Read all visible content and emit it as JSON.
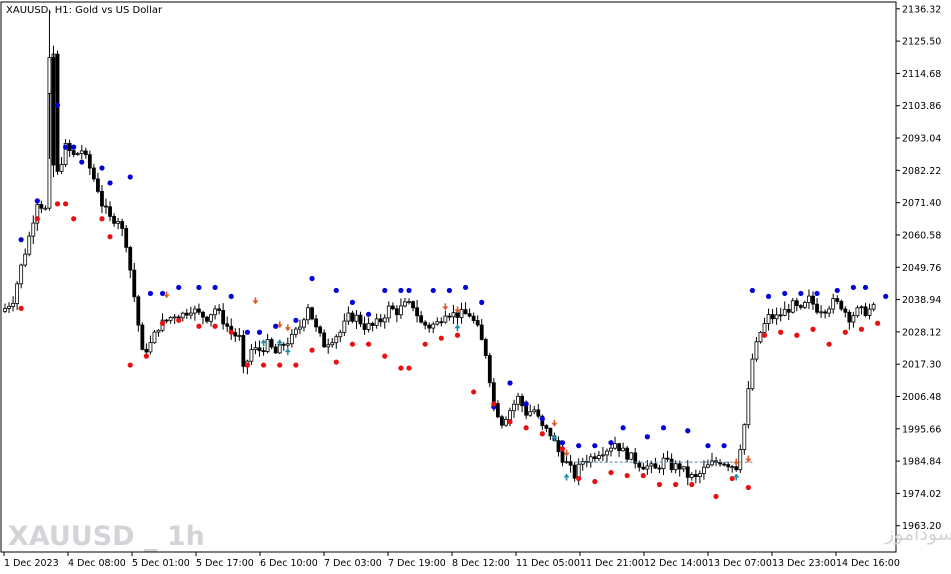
{
  "chart_title": "XAUUSD, H1:  Gold vs US Dollar",
  "watermark_symbol": "XAUUSD _ 1h",
  "watermark_site": "انتشار در سایت سودآموز",
  "colors": {
    "background": "#ffffff",
    "candle_bull": "#ffffff",
    "candle_bear": "#000000",
    "signal_high": "#0000d8",
    "signal_low": "#e81010",
    "arrow_down": "#e05a2a",
    "arrow_up": "#1d8fb0",
    "level_line": "#5a8a9c"
  },
  "chart_data": {
    "type": "candlestick",
    "symbol": "XAUUSD",
    "timeframe": "H1",
    "ylim": [
      1954.4,
      2138.6
    ],
    "yticks": [
      "2136.32",
      "2125.50",
      "2114.68",
      "2103.86",
      "2093.04",
      "2082.22",
      "2071.40",
      "2060.58",
      "2049.76",
      "2038.94",
      "2028.12",
      "2017.30",
      "2006.48",
      "1995.66",
      "1984.84",
      "1974.02",
      "1963.20"
    ],
    "xticks": [
      "1 Dec 2023",
      "4 Dec 08:00",
      "5 Dec 01:00",
      "5 Dec 17:00",
      "6 Dec 10:00",
      "7 Dec 03:00",
      "7 Dec 19:00",
      "8 Dec 12:00",
      "11 Dec 05:00",
      "11 Dec 21:00",
      "12 Dec 14:00",
      "13 Dec 07:00",
      "13 Dec 23:00",
      "14 Dec 16:00"
    ],
    "close_path": [
      [
        0,
        2036
      ],
      [
        2,
        2039
      ],
      [
        4,
        2050
      ],
      [
        6,
        2060
      ],
      [
        8,
        2072
      ],
      [
        10,
        2069
      ],
      [
        11,
        2107
      ],
      [
        12,
        2121
      ],
      [
        13,
        2081
      ],
      [
        15,
        2090
      ],
      [
        17,
        2087
      ],
      [
        19,
        2089
      ],
      [
        21,
        2083
      ],
      [
        23,
        2076
      ],
      [
        24,
        2071
      ],
      [
        26,
        2066
      ],
      [
        28,
        2066
      ],
      [
        30,
        2058
      ],
      [
        32,
        2040
      ],
      [
        34,
        2021
      ],
      [
        36,
        2024
      ],
      [
        38,
        2030
      ],
      [
        40,
        2032
      ],
      [
        42,
        2034
      ],
      [
        44,
        2034
      ],
      [
        46,
        2036
      ],
      [
        48,
        2034
      ],
      [
        50,
        2033
      ],
      [
        52,
        2036
      ],
      [
        54,
        2032
      ],
      [
        56,
        2028
      ],
      [
        58,
        2026
      ],
      [
        59,
        2015
      ],
      [
        61,
        2022
      ],
      [
        63,
        2022
      ],
      [
        65,
        2024
      ],
      [
        67,
        2021
      ],
      [
        69,
        2024
      ],
      [
        71,
        2026
      ],
      [
        73,
        2030
      ],
      [
        75,
        2037
      ],
      [
        77,
        2029
      ],
      [
        79,
        2024
      ],
      [
        81,
        2026
      ],
      [
        83,
        2028
      ],
      [
        85,
        2033
      ],
      [
        87,
        2033
      ],
      [
        89,
        2030
      ],
      [
        91,
        2030
      ],
      [
        93,
        2032
      ],
      [
        95,
        2036
      ],
      [
        97,
        2035
      ],
      [
        99,
        2037
      ],
      [
        101,
        2037
      ],
      [
        103,
        2031
      ],
      [
        105,
        2030
      ],
      [
        107,
        2031
      ],
      [
        109,
        2035
      ],
      [
        111,
        2034
      ],
      [
        113,
        2034
      ],
      [
        115,
        2034
      ],
      [
        117,
        2029
      ],
      [
        119,
        2021
      ],
      [
        121,
        2004
      ],
      [
        123,
        1998
      ],
      [
        125,
        2002
      ],
      [
        127,
        2006
      ],
      [
        129,
        2001
      ],
      [
        131,
        2002
      ],
      [
        133,
        1996
      ],
      [
        135,
        1994
      ],
      [
        137,
        1988
      ],
      [
        139,
        1984
      ],
      [
        141,
        1980
      ],
      [
        143,
        1985
      ],
      [
        145,
        1986
      ],
      [
        147,
        1988
      ],
      [
        149,
        1989
      ],
      [
        151,
        1991
      ],
      [
        153,
        1988
      ],
      [
        155,
        1986
      ],
      [
        157,
        1984
      ],
      [
        159,
        1983
      ],
      [
        161,
        1982
      ],
      [
        163,
        1985
      ],
      [
        165,
        1983
      ],
      [
        167,
        1983
      ],
      [
        169,
        1980
      ],
      [
        171,
        1979
      ],
      [
        173,
        1982
      ],
      [
        175,
        1984
      ],
      [
        177,
        1985
      ],
      [
        179,
        1984
      ],
      [
        181,
        1983
      ],
      [
        183,
        1997
      ],
      [
        185,
        2019
      ],
      [
        187,
        2028
      ],
      [
        189,
        2033
      ],
      [
        191,
        2033
      ],
      [
        193,
        2035
      ],
      [
        195,
        2037
      ],
      [
        197,
        2035
      ],
      [
        199,
        2039
      ],
      [
        201,
        2036
      ],
      [
        203,
        2036
      ],
      [
        205,
        2038
      ],
      [
        207,
        2037
      ],
      [
        209,
        2033
      ],
      [
        211,
        2035
      ],
      [
        213,
        2035
      ],
      [
        215,
        2036
      ]
    ],
    "signals_high": [
      [
        4,
        2059
      ],
      [
        8,
        2072
      ],
      [
        13,
        2104
      ],
      [
        15,
        2090
      ],
      [
        17,
        2090
      ],
      [
        19,
        2085
      ],
      [
        24,
        2083
      ],
      [
        26,
        2078
      ],
      [
        31,
        2080
      ],
      [
        36,
        2041
      ],
      [
        39,
        2041
      ],
      [
        43,
        2043
      ],
      [
        48,
        2043
      ],
      [
        52,
        2043
      ],
      [
        56,
        2040
      ],
      [
        60,
        2028
      ],
      [
        63,
        2028
      ],
      [
        67,
        2030
      ],
      [
        72,
        2032
      ],
      [
        76,
        2046
      ],
      [
        82,
        2042
      ],
      [
        86,
        2038
      ],
      [
        90,
        2034
      ],
      [
        94,
        2042
      ],
      [
        98,
        2042
      ],
      [
        100,
        2042
      ],
      [
        106,
        2042
      ],
      [
        110,
        2042
      ],
      [
        114,
        2043
      ],
      [
        118,
        2038
      ],
      [
        121,
        2003
      ],
      [
        125,
        2011
      ],
      [
        129,
        2004
      ],
      [
        133,
        1999
      ],
      [
        138,
        1991
      ],
      [
        142,
        1990
      ],
      [
        146,
        1990
      ],
      [
        150,
        1991
      ],
      [
        153,
        1996
      ],
      [
        159,
        1993
      ],
      [
        163,
        1996
      ],
      [
        169,
        1995
      ],
      [
        174,
        1990
      ],
      [
        178,
        1990
      ],
      [
        185,
        2042
      ],
      [
        189,
        2040
      ],
      [
        193,
        2041
      ],
      [
        197,
        2041
      ],
      [
        201,
        2041
      ],
      [
        206,
        2042
      ],
      [
        210,
        2043
      ],
      [
        213,
        2043
      ],
      [
        218,
        2040
      ],
      [
        221,
        2040
      ]
    ],
    "signals_low": [
      [
        4,
        2036
      ],
      [
        8,
        2066
      ],
      [
        13,
        2071
      ],
      [
        15,
        2071
      ],
      [
        17,
        2066
      ],
      [
        24,
        2066
      ],
      [
        26,
        2060
      ],
      [
        31,
        2017
      ],
      [
        35,
        2020
      ],
      [
        39,
        2031
      ],
      [
        43,
        2032
      ],
      [
        48,
        2030
      ],
      [
        52,
        2030
      ],
      [
        56,
        2028
      ],
      [
        60,
        2017
      ],
      [
        64,
        2017
      ],
      [
        68,
        2017
      ],
      [
        72,
        2017
      ],
      [
        76,
        2022
      ],
      [
        82,
        2018
      ],
      [
        86,
        2024
      ],
      [
        90,
        2024
      ],
      [
        94,
        2020
      ],
      [
        98,
        2016
      ],
      [
        100,
        2016
      ],
      [
        104,
        2024
      ],
      [
        108,
        2026
      ],
      [
        112,
        2027
      ],
      [
        116,
        2008
      ],
      [
        121,
        2004
      ],
      [
        125,
        1998
      ],
      [
        129,
        1996
      ],
      [
        133,
        1994
      ],
      [
        138,
        1989
      ],
      [
        142,
        1979
      ],
      [
        146,
        1978
      ],
      [
        150,
        1981
      ],
      [
        154,
        1980
      ],
      [
        158,
        1980
      ],
      [
        162,
        1977
      ],
      [
        166,
        1977
      ],
      [
        170,
        1977
      ],
      [
        176,
        1973
      ],
      [
        180,
        1979
      ],
      [
        184,
        1976
      ],
      [
        188,
        2027
      ],
      [
        192,
        2028
      ],
      [
        196,
        2027
      ],
      [
        200,
        2029
      ],
      [
        204,
        2024
      ],
      [
        208,
        2028
      ],
      [
        212,
        2029
      ],
      [
        216,
        2031
      ],
      [
        220,
        2031
      ]
    ],
    "arrows_down": [
      [
        40,
        2040
      ],
      [
        62,
        2038
      ],
      [
        68,
        2030
      ],
      [
        70,
        2029
      ],
      [
        109,
        2036
      ],
      [
        112,
        2035
      ],
      [
        136,
        1997
      ],
      [
        139,
        1987
      ],
      [
        181,
        1984
      ],
      [
        184,
        1985
      ]
    ],
    "arrows_up": [
      [
        64,
        2025
      ],
      [
        68,
        2025
      ],
      [
        70,
        2022
      ],
      [
        112,
        2030
      ],
      [
        136,
        1993
      ],
      [
        139,
        1980
      ],
      [
        181,
        1980
      ]
    ],
    "level_line": {
      "y": 1984.5,
      "x_from": 141,
      "x_to": 185
    }
  }
}
